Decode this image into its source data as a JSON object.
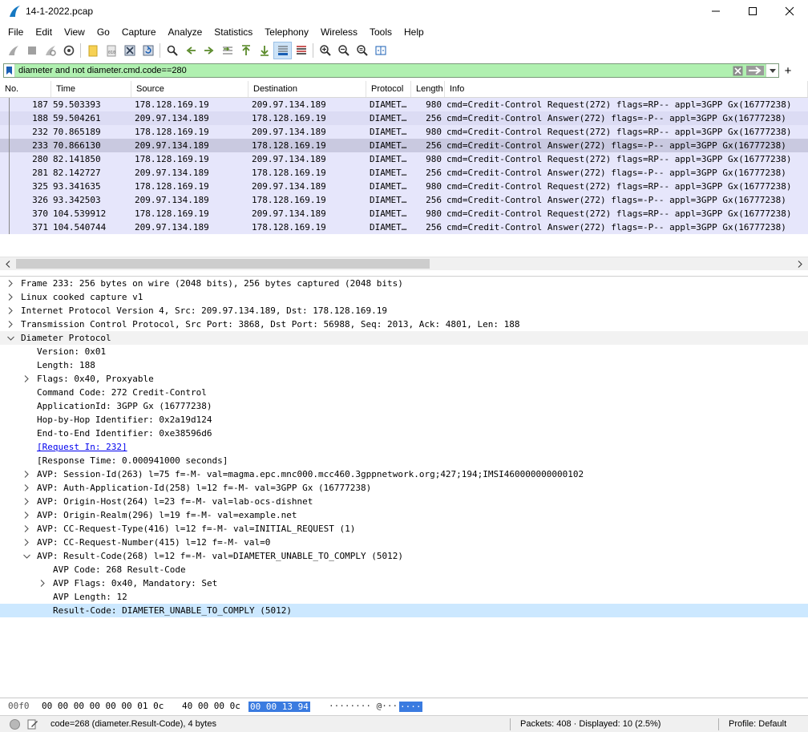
{
  "window": {
    "title": "14-1-2022.pcap"
  },
  "menu": [
    "File",
    "Edit",
    "View",
    "Go",
    "Capture",
    "Analyze",
    "Statistics",
    "Telephony",
    "Wireless",
    "Tools",
    "Help"
  ],
  "toolbar_icons": [
    "start-capture-icon",
    "stop-capture-icon",
    "restart-capture-icon",
    "capture-options-icon",
    "open-file-icon",
    "save-file-icon",
    "close-file-icon",
    "reload-file-icon",
    "find-packet-icon",
    "go-back-icon",
    "go-forward-icon",
    "go-to-packet-icon",
    "go-first-icon",
    "go-last-icon",
    "auto-scroll-icon",
    "colorize-icon",
    "zoom-in-icon",
    "zoom-out-icon",
    "zoom-normal-icon",
    "resize-columns-icon"
  ],
  "filter": {
    "value": "diameter and not diameter.cmd.code==280",
    "color": "#b0f0b0"
  },
  "packet_list": {
    "columns": [
      "No.",
      "Time",
      "Source",
      "Destination",
      "Protocol",
      "Length",
      "Info"
    ],
    "rows": [
      {
        "no": "187",
        "time": "59.503393",
        "src": "178.128.169.19",
        "dst": "209.97.134.189",
        "proto": "DIAMET…",
        "len": "980",
        "info": "cmd=Credit-Control Request(272) flags=RP-- appl=3GPP Gx(16777238)"
      },
      {
        "no": "188",
        "time": "59.504261",
        "src": "209.97.134.189",
        "dst": "178.128.169.19",
        "proto": "DIAMET…",
        "len": "256",
        "info": "cmd=Credit-Control Answer(272) flags=-P-- appl=3GPP Gx(16777238)"
      },
      {
        "no": "232",
        "time": "70.865189",
        "src": "178.128.169.19",
        "dst": "209.97.134.189",
        "proto": "DIAMET…",
        "len": "980",
        "info": "cmd=Credit-Control Request(272) flags=RP-- appl=3GPP Gx(16777238)"
      },
      {
        "no": "233",
        "time": "70.866130",
        "src": "209.97.134.189",
        "dst": "178.128.169.19",
        "proto": "DIAMET…",
        "len": "256",
        "info": "cmd=Credit-Control Answer(272) flags=-P-- appl=3GPP Gx(16777238)"
      },
      {
        "no": "280",
        "time": "82.141850",
        "src": "178.128.169.19",
        "dst": "209.97.134.189",
        "proto": "DIAMET…",
        "len": "980",
        "info": "cmd=Credit-Control Request(272) flags=RP-- appl=3GPP Gx(16777238)"
      },
      {
        "no": "281",
        "time": "82.142727",
        "src": "209.97.134.189",
        "dst": "178.128.169.19",
        "proto": "DIAMET…",
        "len": "256",
        "info": "cmd=Credit-Control Answer(272) flags=-P-- appl=3GPP Gx(16777238)"
      },
      {
        "no": "325",
        "time": "93.341635",
        "src": "178.128.169.19",
        "dst": "209.97.134.189",
        "proto": "DIAMET…",
        "len": "980",
        "info": "cmd=Credit-Control Request(272) flags=RP-- appl=3GPP Gx(16777238)"
      },
      {
        "no": "326",
        "time": "93.342503",
        "src": "209.97.134.189",
        "dst": "178.128.169.19",
        "proto": "DIAMET…",
        "len": "256",
        "info": "cmd=Credit-Control Answer(272) flags=-P-- appl=3GPP Gx(16777238)"
      },
      {
        "no": "370",
        "time": "104.539912",
        "src": "178.128.169.19",
        "dst": "209.97.134.189",
        "proto": "DIAMET…",
        "len": "980",
        "info": "cmd=Credit-Control Request(272) flags=RP-- appl=3GPP Gx(16777238)"
      },
      {
        "no": "371",
        "time": "104.540744",
        "src": "209.97.134.189",
        "dst": "178.128.169.19",
        "proto": "DIAMET…",
        "len": "256",
        "info": "cmd=Credit-Control Answer(272) flags=-P-- appl=3GPP Gx(16777238)"
      }
    ],
    "selected_row": "233",
    "row_color": "#e6e6fb",
    "selected_color": "#c9c9e0"
  },
  "details": [
    "Frame 233: 256 bytes on wire (2048 bits), 256 bytes captured (2048 bits)",
    "Linux cooked capture v1",
    "Internet Protocol Version 4, Src: 209.97.134.189, Dst: 178.128.169.19",
    "Transmission Control Protocol, Src Port: 3868, Dst Port: 56988, Seq: 2013, Ack: 4801, Len: 188",
    "Diameter Protocol",
    "Version: 0x01",
    "Length: 188",
    "Flags: 0x40, Proxyable",
    "Command Code: 272 Credit-Control",
    "ApplicationId: 3GPP Gx (16777238)",
    "Hop-by-Hop Identifier: 0x2a19d124",
    "End-to-End Identifier: 0xe38596d6",
    "[Request In: 232]",
    "[Response Time: 0.000941000 seconds]",
    "AVP: Session-Id(263) l=75 f=-M- val=magma.epc.mnc000.mcc460.3gppnetwork.org;427;194;IMSI460000000000102",
    "AVP: Auth-Application-Id(258) l=12 f=-M- val=3GPP Gx (16777238)",
    "AVP: Origin-Host(264) l=23 f=-M- val=lab-ocs-dishnet",
    "AVP: Origin-Realm(296) l=19 f=-M- val=example.net",
    "AVP: CC-Request-Type(416) l=12 f=-M- val=INITIAL_REQUEST (1)",
    "AVP: CC-Request-Number(415) l=12 f=-M- val=0",
    "AVP: Result-Code(268) l=12 f=-M- val=DIAMETER_UNABLE_TO_COMPLY (5012)",
    "AVP Code: 268 Result-Code",
    "AVP Flags: 0x40, Mandatory: Set",
    "AVP Length: 12",
    "Result-Code: DIAMETER_UNABLE_TO_COMPLY (5012)"
  ],
  "bytes": {
    "offset": "00f0",
    "hex_group1": "00 00 00 00 00 00 01 0c",
    "hex_group2": "40 00 00 0c",
    "hex_selected": "00 00 13 94",
    "ascii": "········ @···",
    "ascii_selected": "····",
    "highlight_color": "#3a7be0"
  },
  "status": {
    "field": "code=268 (diameter.Result-Code), 4 bytes",
    "packets": "Packets: 408 · Displayed: 10 (2.5%)",
    "profile": "Profile: Default"
  }
}
